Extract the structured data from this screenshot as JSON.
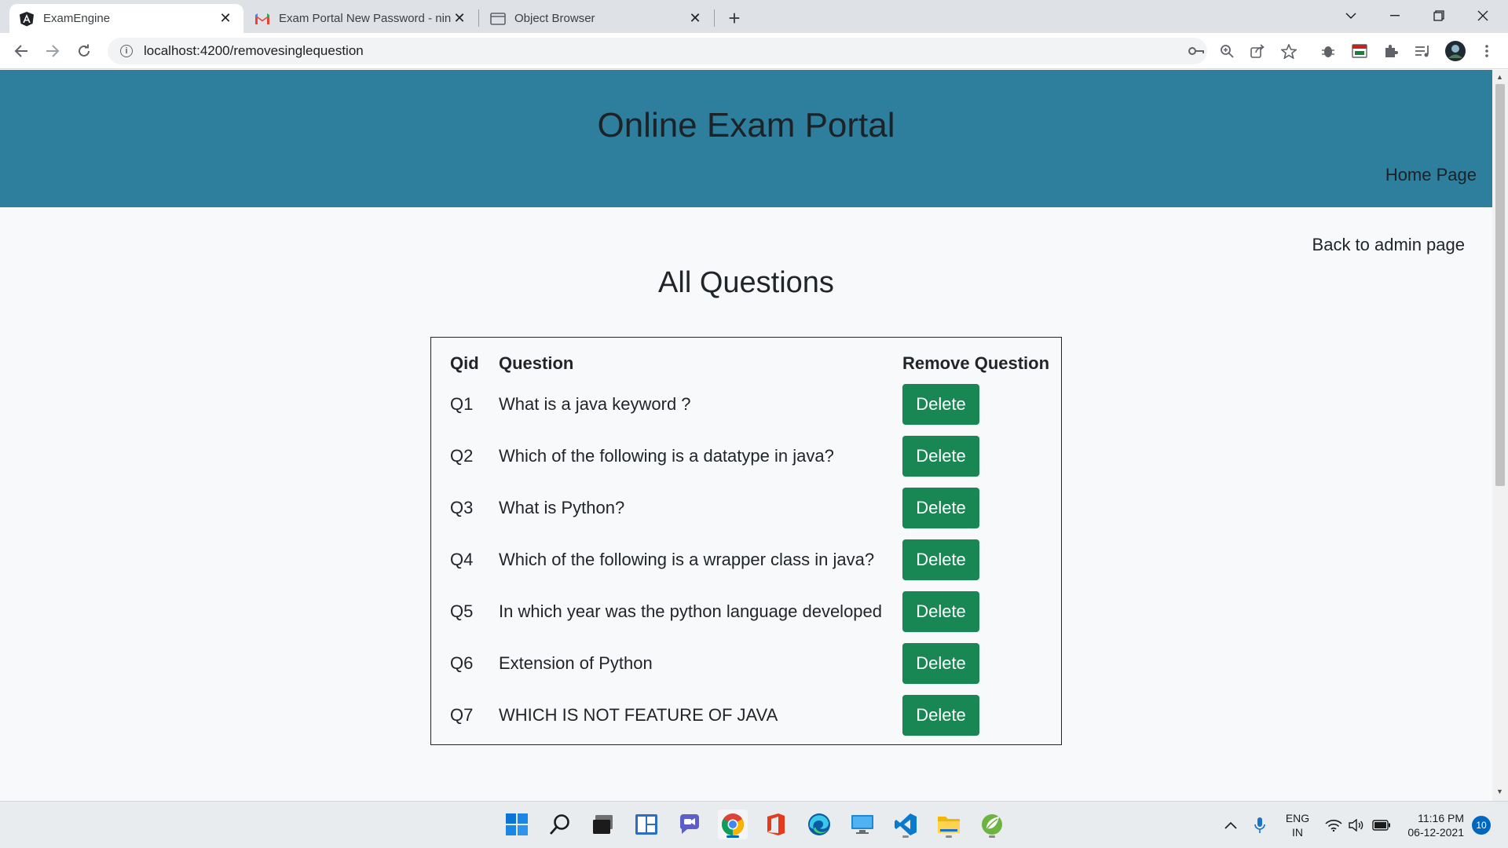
{
  "browser": {
    "tabs": [
      {
        "title": "ExamEngine",
        "icon": "angular-icon",
        "active": true
      },
      {
        "title": "Exam Portal New Password - nina",
        "icon": "gmail-icon",
        "active": false
      },
      {
        "title": "Object Browser",
        "icon": "page-icon",
        "active": false
      }
    ],
    "url": "localhost:4200/removesinglequestion"
  },
  "header": {
    "site_title": "Online Exam Portal",
    "home_link": "Home Page"
  },
  "page": {
    "back_link": "Back to admin page",
    "heading": "All Questions"
  },
  "table": {
    "columns": [
      "Qid",
      "Question",
      "Remove Question"
    ],
    "delete_label": "Delete",
    "rows": [
      {
        "qid": "Q1",
        "question": "What is a java keyword ?"
      },
      {
        "qid": "Q2",
        "question": "Which of the following is a datatype in java?"
      },
      {
        "qid": "Q3",
        "question": "What is Python?"
      },
      {
        "qid": "Q4",
        "question": "Which of the following is a wrapper class in java?"
      },
      {
        "qid": "Q5",
        "question": "In which year was the python language developed"
      },
      {
        "qid": "Q6",
        "question": "Extension of Python"
      },
      {
        "qid": "Q7",
        "question": "WHICH IS NOT FEATURE OF JAVA"
      }
    ]
  },
  "taskbar": {
    "language": "ENG",
    "region": "IN",
    "time": "11:16 PM",
    "date": "06-12-2021",
    "notifications": "10"
  },
  "colors": {
    "header_bg": "#2d7f9d",
    "delete_button": "#198754"
  }
}
